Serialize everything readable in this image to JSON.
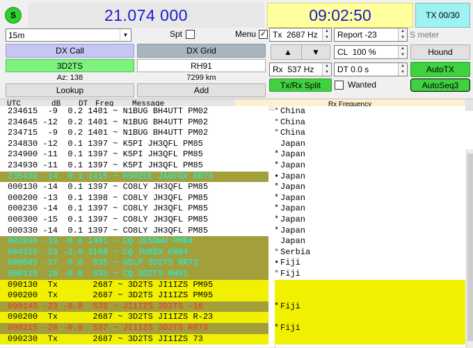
{
  "top": {
    "status_icon": "S",
    "dial_freq": "21.074 000",
    "clock": "09:02:50",
    "tx_counter": "TX 00/30"
  },
  "controls": {
    "band": "15m",
    "spt_label": "Spt",
    "menu_label": "Menu",
    "dx_call_label": "DX Call",
    "dx_grid_label": "DX Grid",
    "dx_call": "3D2TS",
    "dx_grid": "RH91",
    "azimuth": "Az: 138",
    "distance": "7299 km",
    "lookup_label": "Lookup",
    "add_label": "Add",
    "tx_label": "Tx  2687 Hz",
    "report_label": "Report -23",
    "smeter_label": "S meter",
    "up_arrow": "▲",
    "down_arrow": "▼",
    "cl_label": "CL  100 %",
    "hound_label": "Hound",
    "rx_label": "Rx  537 Hz",
    "dt_label": "DT 0.0 s",
    "autotx_label": "AutoTX",
    "split_label": "Tx/Rx Split",
    "wanted_label": "Wanted",
    "autoseq_label": "AutoSeq3"
  },
  "colors": {
    "green": "#7ef27e",
    "olive": "#a39f3b",
    "yellow": "#f0f000",
    "cyan": "#00ffff",
    "red": "#ff2b2b",
    "clock_bg": "#ffff9e",
    "tx_bg": "#9ef2f2",
    "rxfreq_bg": "#fdf0d0"
  },
  "header": {
    "utc": "UTC",
    "db": "dB",
    "dt": "DT",
    "freq": "Freq",
    "message": "Message",
    "rx_frequency": "Rx Frequency"
  },
  "rows": [
    {
      "text": "234615  -9  0.2 1401 ~ N1BUG BH4UTT PM02",
      "country": "China",
      "marker": "°",
      "style": "plain"
    },
    {
      "text": "234645 -12  0.2 1401 ~ N1BUG BH4UTT PM02",
      "country": "China",
      "marker": "°",
      "style": "plain"
    },
    {
      "text": "234715  -9  0.2 1401 ~ N1BUG BH4UTT PM02",
      "country": "China",
      "marker": "°",
      "style": "plain"
    },
    {
      "text": "234830 -12  0.1 1397 ~ K5PI JH3QFL PM85",
      "country": "Japan",
      "marker": "",
      "style": "plain"
    },
    {
      "text": "234900 -11  0.1 1397 ~ K5PI JH3QFL PM85",
      "country": "Japan",
      "marker": "*",
      "style": "plain"
    },
    {
      "text": "234930 -11  0.1 1397 ~ K5PI JH3QFL PM85",
      "country": "Japan",
      "marker": "*",
      "style": "plain"
    },
    {
      "text": "235430 -14  0.1 1415 ~ HS0ZEE JA0FOX RR73",
      "country": "Japan",
      "marker": "•",
      "style": "olive"
    },
    {
      "text": "000130 -14  0.1 1397 ~ CO8LY JH3QFL PM85",
      "country": "Japan",
      "marker": "*",
      "style": "plain"
    },
    {
      "text": "000200 -13  0.1 1398 ~ CO8LY JH3QFL PM85",
      "country": "Japan",
      "marker": "*",
      "style": "plain"
    },
    {
      "text": "000230 -14  0.1 1397 ~ CO8LY JH3QFL PM85",
      "country": "Japan",
      "marker": "*",
      "style": "plain"
    },
    {
      "text": "000300 -15  0.1 1397 ~ CO8LY JH3QFL PM85",
      "country": "Japan",
      "marker": "*",
      "style": "plain"
    },
    {
      "text": "000330 -14  0.1 1397 ~ CO8LY JH3QFL PM85",
      "country": "Japan",
      "marker": "*",
      "style": "plain"
    },
    {
      "text": "002930 -19 -0.0 1401 ~ CQ JE5DWU PM64",
      "country": "Japan",
      "marker": "",
      "style": "cq"
    },
    {
      "text": "004215 -23 -2.9 3168 ~ CQ YU6DX KN04",
      "country": "Serbia",
      "marker": "°",
      "style": "cq"
    },
    {
      "text": "090045 -17  0.0  535 ~ G5LP 3D2TS RR73",
      "country": "Fiji",
      "marker": "•",
      "style": "cq"
    },
    {
      "text": "090115 -18 -0.0  535 ~ CQ 3D2TS RH91",
      "country": "Fiji",
      "marker": "°",
      "style": "cq"
    },
    {
      "text": "090130  Tx       2687 ~ 3D2TS JI1IZS PM95",
      "country": "",
      "marker": "",
      "style": "tx"
    },
    {
      "text": "090200  Tx       2687 ~ 3D2TS JI1IZS PM95",
      "country": "",
      "marker": "",
      "style": "tx"
    },
    {
      "text": "090145 -23 -0.0  535 ~ JI1IZS 3D2TS -16",
      "country": "Fiji",
      "marker": "*",
      "style": "me"
    },
    {
      "text": "090200  Tx       2687 ~ 3D2TS JI1IZS R-23",
      "country": "",
      "marker": "",
      "style": "tx"
    },
    {
      "text": "090215 -20 -0.0  537 ~ JI1IZS 3D2TS RR73",
      "country": "Fiji",
      "marker": "*",
      "style": "me"
    },
    {
      "text": "090230  Tx       2687 ~ 3D2TS JI1IZS 73",
      "country": "",
      "marker": "",
      "style": "tx"
    }
  ]
}
